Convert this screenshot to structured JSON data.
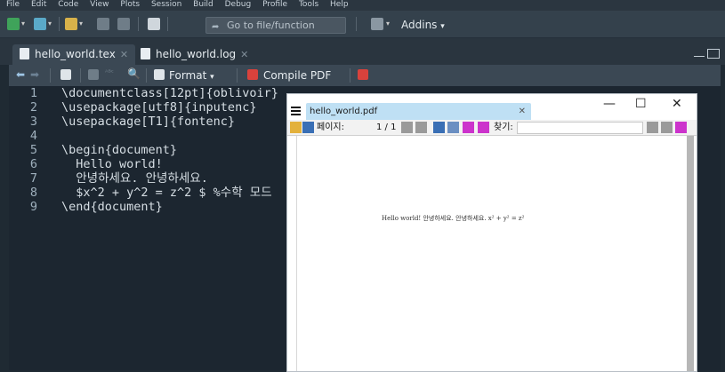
{
  "menu": [
    "File",
    "Edit",
    "Code",
    "View",
    "Plots",
    "Session",
    "Build",
    "Debug",
    "Profile",
    "Tools",
    "Help"
  ],
  "toolbar": {
    "goto_placeholder": "Go to file/function",
    "addins_label": "Addins"
  },
  "tabs": [
    {
      "label": "hello_world.tex",
      "active": true
    },
    {
      "label": "hello_world.log",
      "active": false
    }
  ],
  "editor_toolbar": {
    "format_label": "Format",
    "compile_label": "Compile PDF"
  },
  "editor": {
    "line_numbers": [
      "1",
      "2",
      "3",
      "4",
      "5",
      "6",
      "7",
      "8",
      "9"
    ],
    "lines": [
      "\\documentclass[12pt]{oblivoir}",
      "\\usepackage[utf8]{inputenc}",
      "\\usepackage[T1]{fontenc}",
      "",
      "\\begin{document}",
      "  Hello world!",
      "  안녕하세요. 안녕하세요.",
      "  $x^2 + y^2 = z^2 $ %수학 모드",
      "\\end{document}"
    ]
  },
  "pdf_viewer": {
    "tab_title": "hello_world.pdf",
    "page_label": "페이지:",
    "page_value": "1 / 1",
    "find_label": "찾기:",
    "content": "Hello world! 안녕하세요. 안녕하세요. x² + y² = z²",
    "window_controls": [
      "—",
      "☐",
      "✕"
    ]
  },
  "colors": {
    "accent_blue": "#bfe0f4",
    "magenta": "#cc33cc",
    "dark_bg": "#1c2630"
  }
}
